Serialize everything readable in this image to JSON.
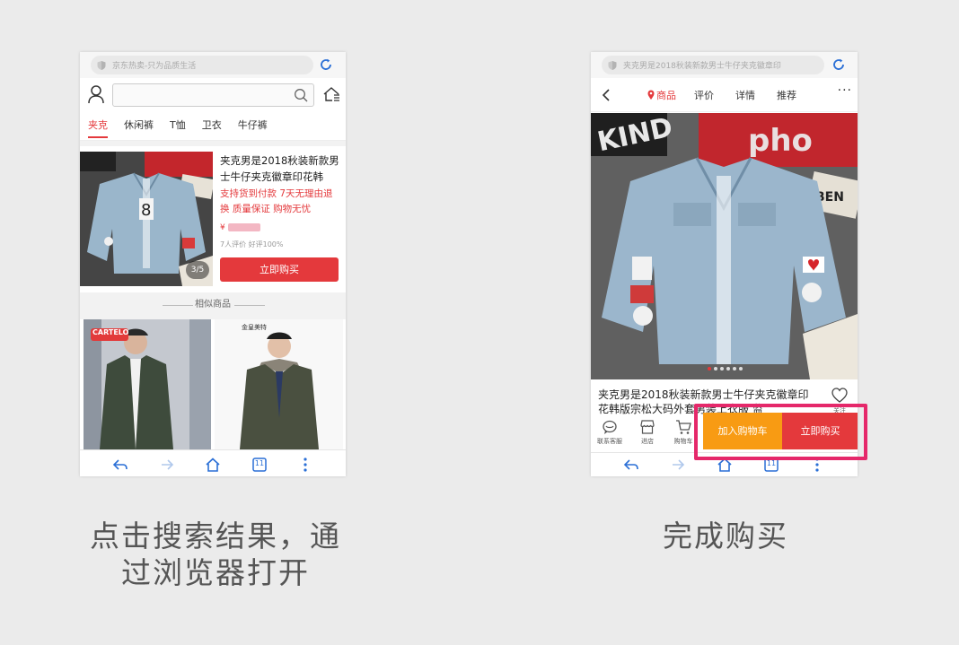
{
  "phone1": {
    "url_text": "京东热卖-只为品质生活",
    "tabs": [
      "夹克",
      "休闲裤",
      "T恤",
      "卫衣",
      "牛仔裤"
    ],
    "product": {
      "title": "夹克男是2018秋装新款男士牛仔夹克徽章印花韩",
      "promo": "支持货到付款 7天无理由退换 质量保证 购物无忧",
      "price_symbol": "¥",
      "rating": "7人评价 好评100%",
      "buy_label": "立即购买",
      "pager": "3/5"
    },
    "similar_label": "相似商品",
    "thumb1_brand": "CARTELO",
    "thumb2_brand": "金皇美特",
    "bottom_page_count": "11"
  },
  "phone2": {
    "url_text": "夹克男是2018秋装新款男士牛仔夹克徽章印",
    "nav_tabs": [
      "商品",
      "评价",
      "详情",
      "推荐"
    ],
    "more": "···",
    "product_title": "夹克男是2018秋装新款男士牛仔夹克徽章印花韩版宗松大码外套男装上衣服 监",
    "follow_label": "关注",
    "actions": [
      "联系客服",
      "进店",
      "购物车"
    ],
    "add_cart_label": "加入购物车",
    "buy_label": "立即购买",
    "bottom_page_count": "11"
  },
  "captions": {
    "left_line1": "点击搜索结果，通",
    "left_line2": "过浏览器打开",
    "right": "完成购买"
  },
  "colors": {
    "accent": "#e4393c",
    "cart": "#f89b13",
    "highlight": "#e5286a",
    "link_blue": "#2a6fd6"
  }
}
